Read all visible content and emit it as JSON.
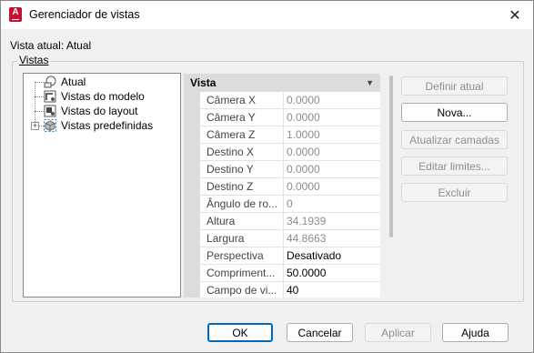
{
  "window": {
    "title": "Gerenciador de vistas",
    "close_glyph": "✕"
  },
  "current_view_label": "Vista atual: Atual",
  "group_label": "Vistas",
  "tree": {
    "items": [
      {
        "label": "Atual",
        "icon": "camera-icon"
      },
      {
        "label": "Vistas do modelo",
        "icon": "model-views-icon"
      },
      {
        "label": "Vistas do layout",
        "icon": "layout-views-icon"
      },
      {
        "label": "Vistas predefinidas",
        "icon": "preset-views-icon",
        "expander": "+"
      }
    ]
  },
  "properties": {
    "category": "Vista",
    "rows": [
      {
        "name": "Câmera X",
        "value": "0.0000",
        "state": "dim"
      },
      {
        "name": "Câmera Y",
        "value": "0.0000",
        "state": "dim"
      },
      {
        "name": "Câmera Z",
        "value": "1.0000",
        "state": "dim"
      },
      {
        "name": "Destino X",
        "value": "0.0000",
        "state": "dim"
      },
      {
        "name": "Destino Y",
        "value": "0.0000",
        "state": "dim"
      },
      {
        "name": "Destino Z",
        "value": "0.0000",
        "state": "dim"
      },
      {
        "name": "Ângulo de ro...",
        "value": "0",
        "state": "dim"
      },
      {
        "name": "Altura",
        "value": "34.1939",
        "state": "dim"
      },
      {
        "name": "Largura",
        "value": "44.8663",
        "state": "dim"
      },
      {
        "name": "Perspectiva",
        "value": "Desativado",
        "state": "active"
      },
      {
        "name": "Compriment...",
        "value": "50.0000",
        "state": "active"
      },
      {
        "name": "Campo de vi...",
        "value": "40",
        "state": "active"
      }
    ]
  },
  "side_buttons": {
    "set_current": "Definir atual",
    "new": "Nova...",
    "update_layers": "Atualizar camadas",
    "edit_boundaries": "Editar limites...",
    "delete": "Excluir"
  },
  "footer_buttons": {
    "ok": "OK",
    "cancel": "Cancelar",
    "apply": "Aplicar",
    "help": "Ajuda"
  }
}
